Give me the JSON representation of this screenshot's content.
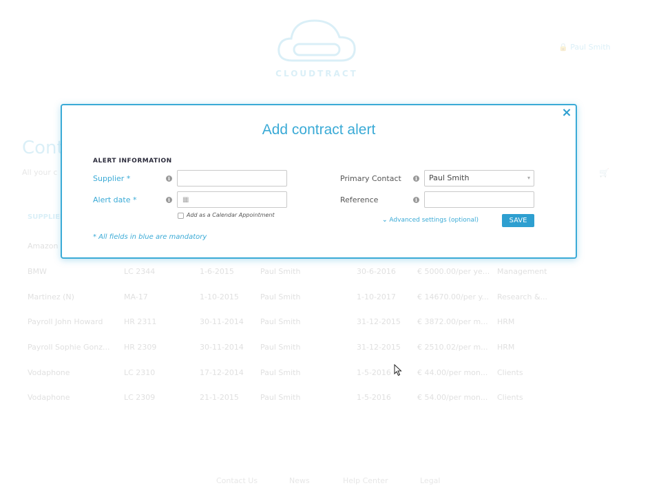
{
  "background": {
    "logo_text": "CLOUDTRACT",
    "user_name": "Paul Smith",
    "page_heading": "Cont",
    "page_sub": "All your c",
    "column_header_first": "SUPPLIER",
    "rows": [
      {
        "supplier": "Amazon",
        "code": "",
        "start": "",
        "contact": "",
        "end": "",
        "value": "",
        "category": ""
      },
      {
        "supplier": "BMW",
        "code": "LC 2344",
        "start": "1-6-2015",
        "contact": "Paul Smith",
        "end": "30-6-2016",
        "value": "€ 5000.00/per ye...",
        "category": "Management"
      },
      {
        "supplier": "Martinez (N)",
        "code": "MA-17",
        "start": "1-10-2015",
        "contact": "Paul Smith",
        "end": "1-10-2017",
        "value": "€ 14670.00/per y...",
        "category": "Research &..."
      },
      {
        "supplier": "Payroll John Howard",
        "code": "HR 2311",
        "start": "30-11-2014",
        "contact": "Paul Smith",
        "end": "31-12-2015",
        "value": "€ 3872.00/per m...",
        "category": "HRM"
      },
      {
        "supplier": "Payroll Sophie Gonz...",
        "code": "HR 2309",
        "start": "30-11-2014",
        "contact": "Paul Smith",
        "end": "31-12-2015",
        "value": "€ 2510.02/per m...",
        "category": "HRM"
      },
      {
        "supplier": "Vodaphone",
        "code": "LC 2310",
        "start": "17-12-2014",
        "contact": "Paul Smith",
        "end": "1-5-2016",
        "value": "€ 44.00/per mon...",
        "category": "Clients"
      },
      {
        "supplier": "Vodaphone",
        "code": "LC 2309",
        "start": "21-1-2015",
        "contact": "Paul Smith",
        "end": "1-5-2016",
        "value": "€ 54.00/per mon...",
        "category": "Clients"
      }
    ],
    "footer_links": [
      "Contact Us",
      "News",
      "Help Center",
      "Legal"
    ]
  },
  "modal": {
    "title": "Add contract alert",
    "section_label": "ALERT INFORMATION",
    "fields": {
      "supplier_label": "Supplier *",
      "supplier_value": "",
      "alert_date_label": "Alert date *",
      "alert_date_value": "",
      "calendar_checkbox_label": "Add as a Calendar Appointment",
      "primary_contact_label": "Primary Contact",
      "primary_contact_value": "Paul Smith",
      "reference_label": "Reference",
      "reference_value": ""
    },
    "advanced_link": "Advanced settings (optional)",
    "save_label": "SAVE",
    "mandatory_note": "* All fields in blue are mandatory",
    "close_icon": "×"
  },
  "colors": {
    "accent": "#3aaad6",
    "button": "#2e9fd0",
    "section_label": "#2a2a3a"
  },
  "icons": {
    "close": "close-icon",
    "info": "info-icon",
    "calendar": "calendar-icon",
    "chevron": "chevron-down-icon",
    "lock": "lock-icon",
    "cart": "search-icon"
  }
}
